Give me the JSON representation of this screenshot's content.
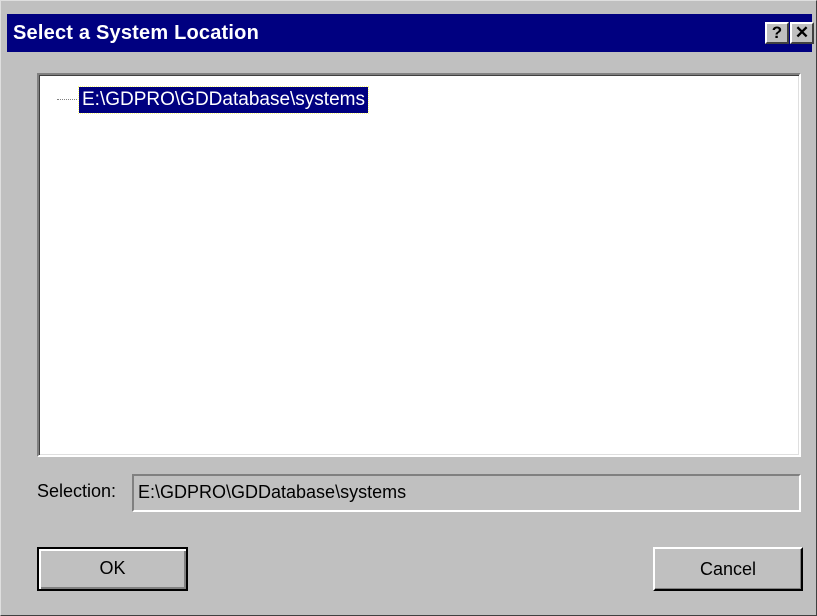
{
  "window": {
    "title": "Select a System Location",
    "help_glyph": "?",
    "close_glyph": "✕"
  },
  "tree": {
    "items": [
      {
        "label": "E:\\GDPRO\\GDDatabase\\systems",
        "selected": true
      }
    ]
  },
  "selection": {
    "label": "Selection:",
    "value": "E:\\GDPRO\\GDDatabase\\systems"
  },
  "buttons": {
    "ok_label": "OK",
    "cancel_label": "Cancel"
  },
  "colors": {
    "titlebar": "#000080",
    "face": "#c0c0c0",
    "selection_highlight": "#000080"
  }
}
